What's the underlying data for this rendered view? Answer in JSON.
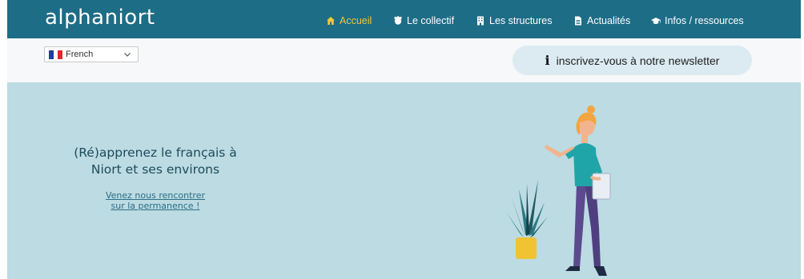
{
  "header": {
    "logo": "alphaniort",
    "nav": [
      {
        "label": "Accueil",
        "icon": "home-icon",
        "active": true
      },
      {
        "label": "Le collectif",
        "icon": "collective-icon",
        "active": false
      },
      {
        "label": "Les structures",
        "icon": "building-icon",
        "active": false
      },
      {
        "label": "Actualités",
        "icon": "document-icon",
        "active": false
      },
      {
        "label": "Infos / ressources",
        "icon": "graduation-cap-icon",
        "active": false
      }
    ]
  },
  "subbar": {
    "language": "French",
    "newsletter_label": "inscrivez-vous à notre newsletter"
  },
  "hero": {
    "title_line1": "(Ré)apprenez le français à",
    "title_line2": "Niort et ses environs",
    "link_line1": "Venez nous rencontrer",
    "link_line2": "sur la permanence !"
  },
  "colors": {
    "header_bg": "#1d6d86",
    "active_nav": "#f2c53d",
    "hero_bg": "#bcdbe2",
    "newsletter_bg": "#dcebf2"
  }
}
